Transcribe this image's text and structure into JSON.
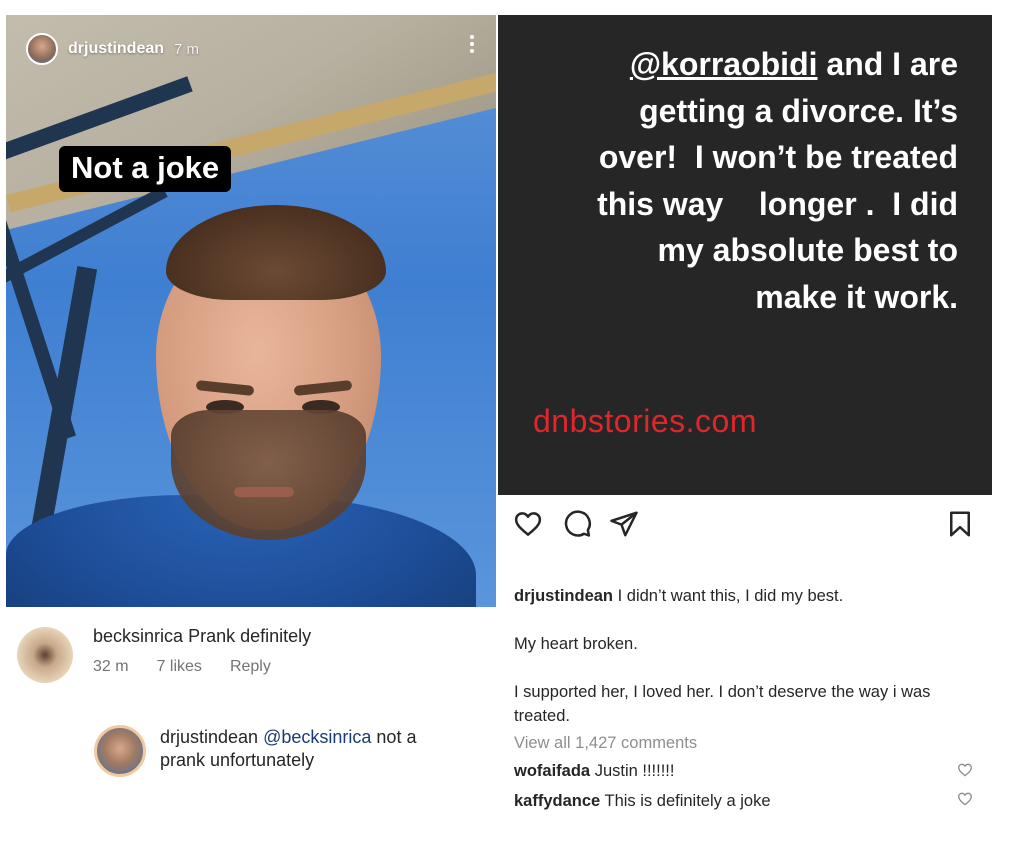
{
  "story": {
    "username": "drjustindean",
    "time": "7 m",
    "sticker_text": "Not a joke"
  },
  "left_comments": {
    "comment1": {
      "username": "becksinrica",
      "text": "Prank definitely",
      "time": "32 m",
      "likes": "7 likes",
      "reply_label": "Reply"
    },
    "comment2": {
      "username": "drjustindean",
      "mention": "@becksinrica",
      "text_part1": "not a",
      "text_part2": "prank unfortunately"
    }
  },
  "post": {
    "text_mention": "@korraobidi",
    "text_line1_rest": " and I are",
    "text_line2": "getting a divorce. It’s",
    "text_line3": "over!  I won’t be treated",
    "text_line4": "this way    longer .  I did",
    "text_line5": "my absolute best to",
    "text_line6": "make it work.",
    "watermark": "dnbstories.com",
    "watermark_color": "#e0262a",
    "background_color": "#262626"
  },
  "actions": {
    "like_icon": "heart-icon",
    "comment_icon": "comment-icon",
    "share_icon": "send-icon",
    "save_icon": "bookmark-icon"
  },
  "caption": {
    "username": "drjustindean",
    "line1": "I didn’t want this, I did my best.",
    "line2": "My heart broken.",
    "line3": "I supported her, I loved her. I don’t deserve the way i was treated."
  },
  "view_all_comments": "View all 1,427 comments",
  "post_comments": [
    {
      "username": "wofaifada",
      "text": "Justin !!!!!!!"
    },
    {
      "username": "kaffydance",
      "text": "This is definitely a joke"
    }
  ]
}
